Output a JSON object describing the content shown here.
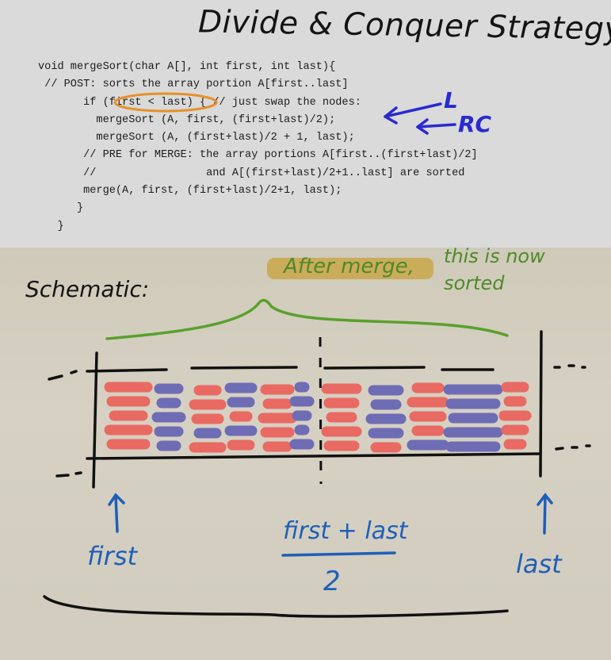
{
  "slide": {
    "title": "Divide & Conquer Strategy",
    "code_lines": [
      "void mergeSort(char A[], int first, int last){",
      " // POST: sorts the array portion A[first..last]",
      "       if (first < last) { // just swap the nodes:",
      "         mergeSort (A, first, (first+last)/2);",
      "         mergeSort (A, (first+last)/2 + 1, last);",
      "       // PRE for MERGE: the array portions A[first..(first+last)/2]",
      "       //                 and A[(first+last)/2+1..last] are sorted",
      "       merge(A, first, (first+last)/2+1, last);",
      "      }",
      "   }"
    ],
    "annotations": {
      "lc": "L",
      "rc": "RC",
      "highlight_text": "After merge,",
      "note_text": "this is now sorted",
      "schematic": "Schematic:",
      "first_label": "first",
      "last_label": "last",
      "mid_numerator": "first + last",
      "mid_denominator": "2"
    },
    "colors": {
      "red_element": "#e96a62",
      "blue_element": "#6f6cb6",
      "annotation_blue": "#1f5fb8",
      "ink_blue": "#2a2ad0",
      "green_brace": "#5aa02c",
      "highlight_orange": "#e8902a",
      "highlight_gold": "#c9a23a"
    }
  }
}
